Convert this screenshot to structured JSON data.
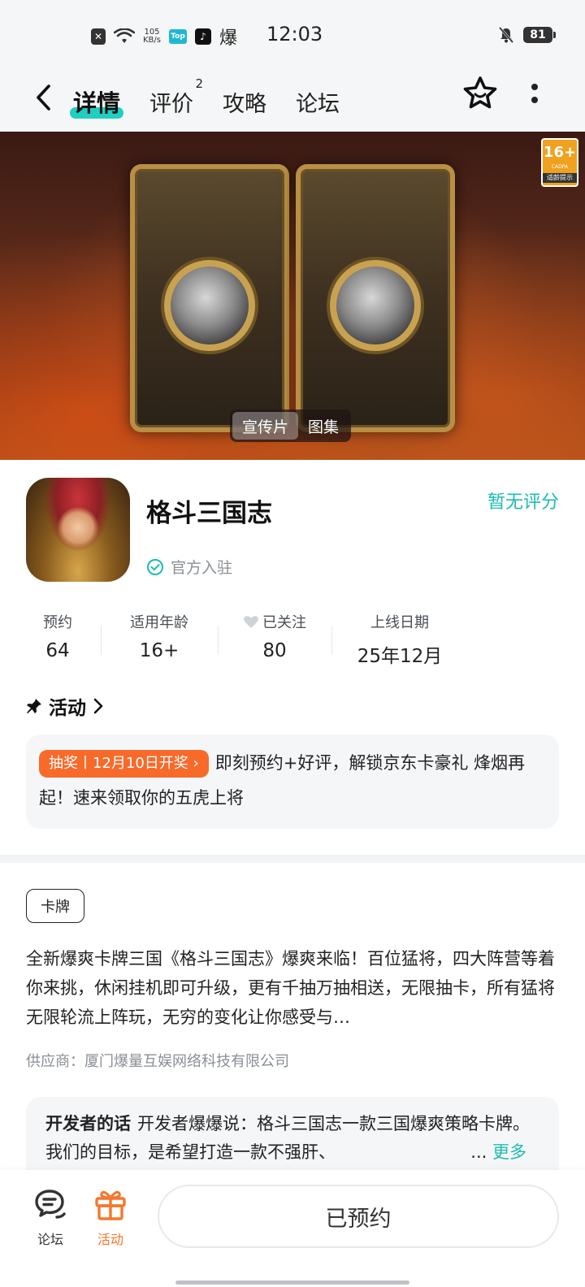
{
  "status_bar": {
    "net_speed_top": "105",
    "net_speed_bottom": "KB/s",
    "top_app_label": "Top",
    "bao_label": "爆",
    "time": "12:03",
    "battery": "81"
  },
  "nav": {
    "tabs": [
      {
        "label": "详情",
        "active": true
      },
      {
        "label": "评价",
        "badge": "2"
      },
      {
        "label": "攻略"
      },
      {
        "label": "论坛"
      }
    ]
  },
  "banner": {
    "age_rating": "16+",
    "age_rating_org": "CADPA",
    "age_rating_tip": "适龄提示",
    "media_tabs": [
      "宣传片",
      "图集"
    ],
    "active_media": "宣传片"
  },
  "game": {
    "title": "格斗三国志",
    "official_label": "官方入驻",
    "score_label": "暂无评分"
  },
  "stats": [
    {
      "label": "预约",
      "value": "64"
    },
    {
      "label": "适用年龄",
      "value": "16+"
    },
    {
      "label": "已关注",
      "value": "80"
    },
    {
      "label": "上线日期",
      "value": "25年12月"
    }
  ],
  "activity": {
    "heading": "活动",
    "tag": "抽奖丨12月10日开奖",
    "text": "即刻预约+好评，解锁京东卡豪礼 烽烟再起！速来领取你的五虎上将"
  },
  "genre_tag": "卡牌",
  "description": "全新爆爽卡牌三国《格斗三国志》爆爽来临！百位猛将，四大阵营等着你来挑，休闲挂机即可升级，更有千抽万抽相送，无限抽卡，所有猛将无限轮流上阵玩，无穷的变化让你感受与…",
  "supplier": "供应商：厦门爆量互娱网络科技有限公司",
  "developer": {
    "title": "开发者的话",
    "text": "开发者爆爆说：格斗三国志一款三国爆爽策略卡牌。我们的目标，是希望打造一款不强肝、",
    "ellipsis": "...",
    "more": "更多"
  },
  "bottom_bar": {
    "forum_label": "论坛",
    "activity_label": "活动",
    "reserve_button": "已预约"
  },
  "colors": {
    "accent": "#1bbcb0",
    "tab_highlight": "#1ecfc2",
    "activity_orange": "#f86a2a",
    "bottom_active": "#f5772d"
  }
}
